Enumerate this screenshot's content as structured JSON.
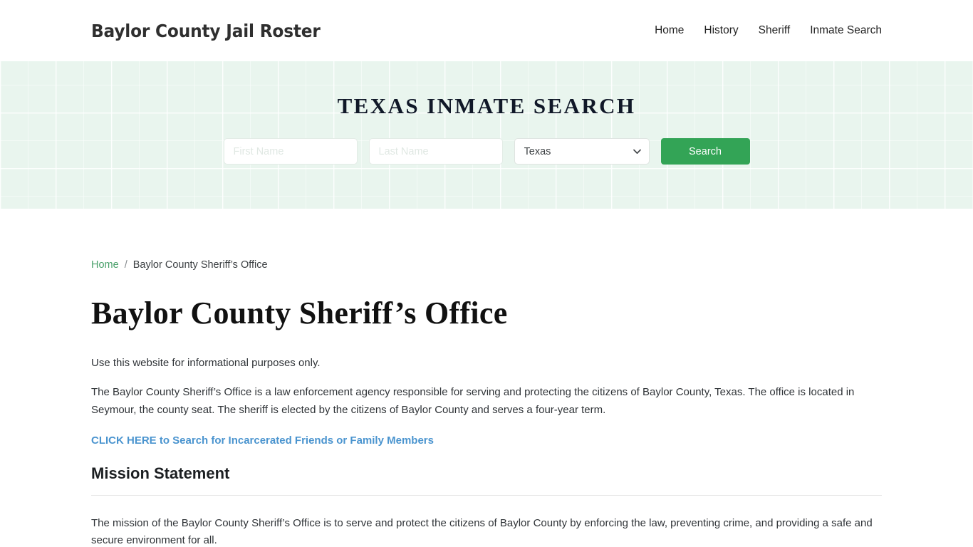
{
  "header": {
    "brand": "Baylor County Jail Roster",
    "nav": [
      {
        "label": "Home"
      },
      {
        "label": "History"
      },
      {
        "label": "Sheriff"
      },
      {
        "label": "Inmate Search"
      }
    ]
  },
  "hero": {
    "title": "TEXAS INMATE SEARCH",
    "first_name_placeholder": "First Name",
    "first_name_value": "",
    "last_name_placeholder": "Last Name",
    "last_name_value": "",
    "state_selected": "Texas",
    "state_options": [
      "Texas"
    ],
    "search_button": "Search",
    "accent_green": "#33a456",
    "background_tint": "#e9f5ee"
  },
  "breadcrumb": {
    "home": "Home",
    "separator": "/",
    "current": "Baylor County Sheriff’s Office",
    "link_color": "#49a06a"
  },
  "content": {
    "page_title": "Baylor County Sheriff’s Office",
    "lede": "Use this website for informational purposes only.",
    "intro_paragraph": "The Baylor County Sheriff’s Office is a law enforcement agency responsible for serving and protecting the citizens of Baylor County, Texas. The office is located in Seymour, the county seat. The sheriff is elected by the citizens of Baylor County and serves a four-year term.",
    "cta_link": "CLICK HERE to Search for Incarcerated Friends or Family Members",
    "cta_color": "#4a94cf",
    "section_title": "Mission Statement",
    "mission_paragraph": "The mission of the Baylor County Sheriff’s Office is to serve and protect the citizens of Baylor County by enforcing the law, preventing crime, and providing a safe and secure environment for all."
  }
}
